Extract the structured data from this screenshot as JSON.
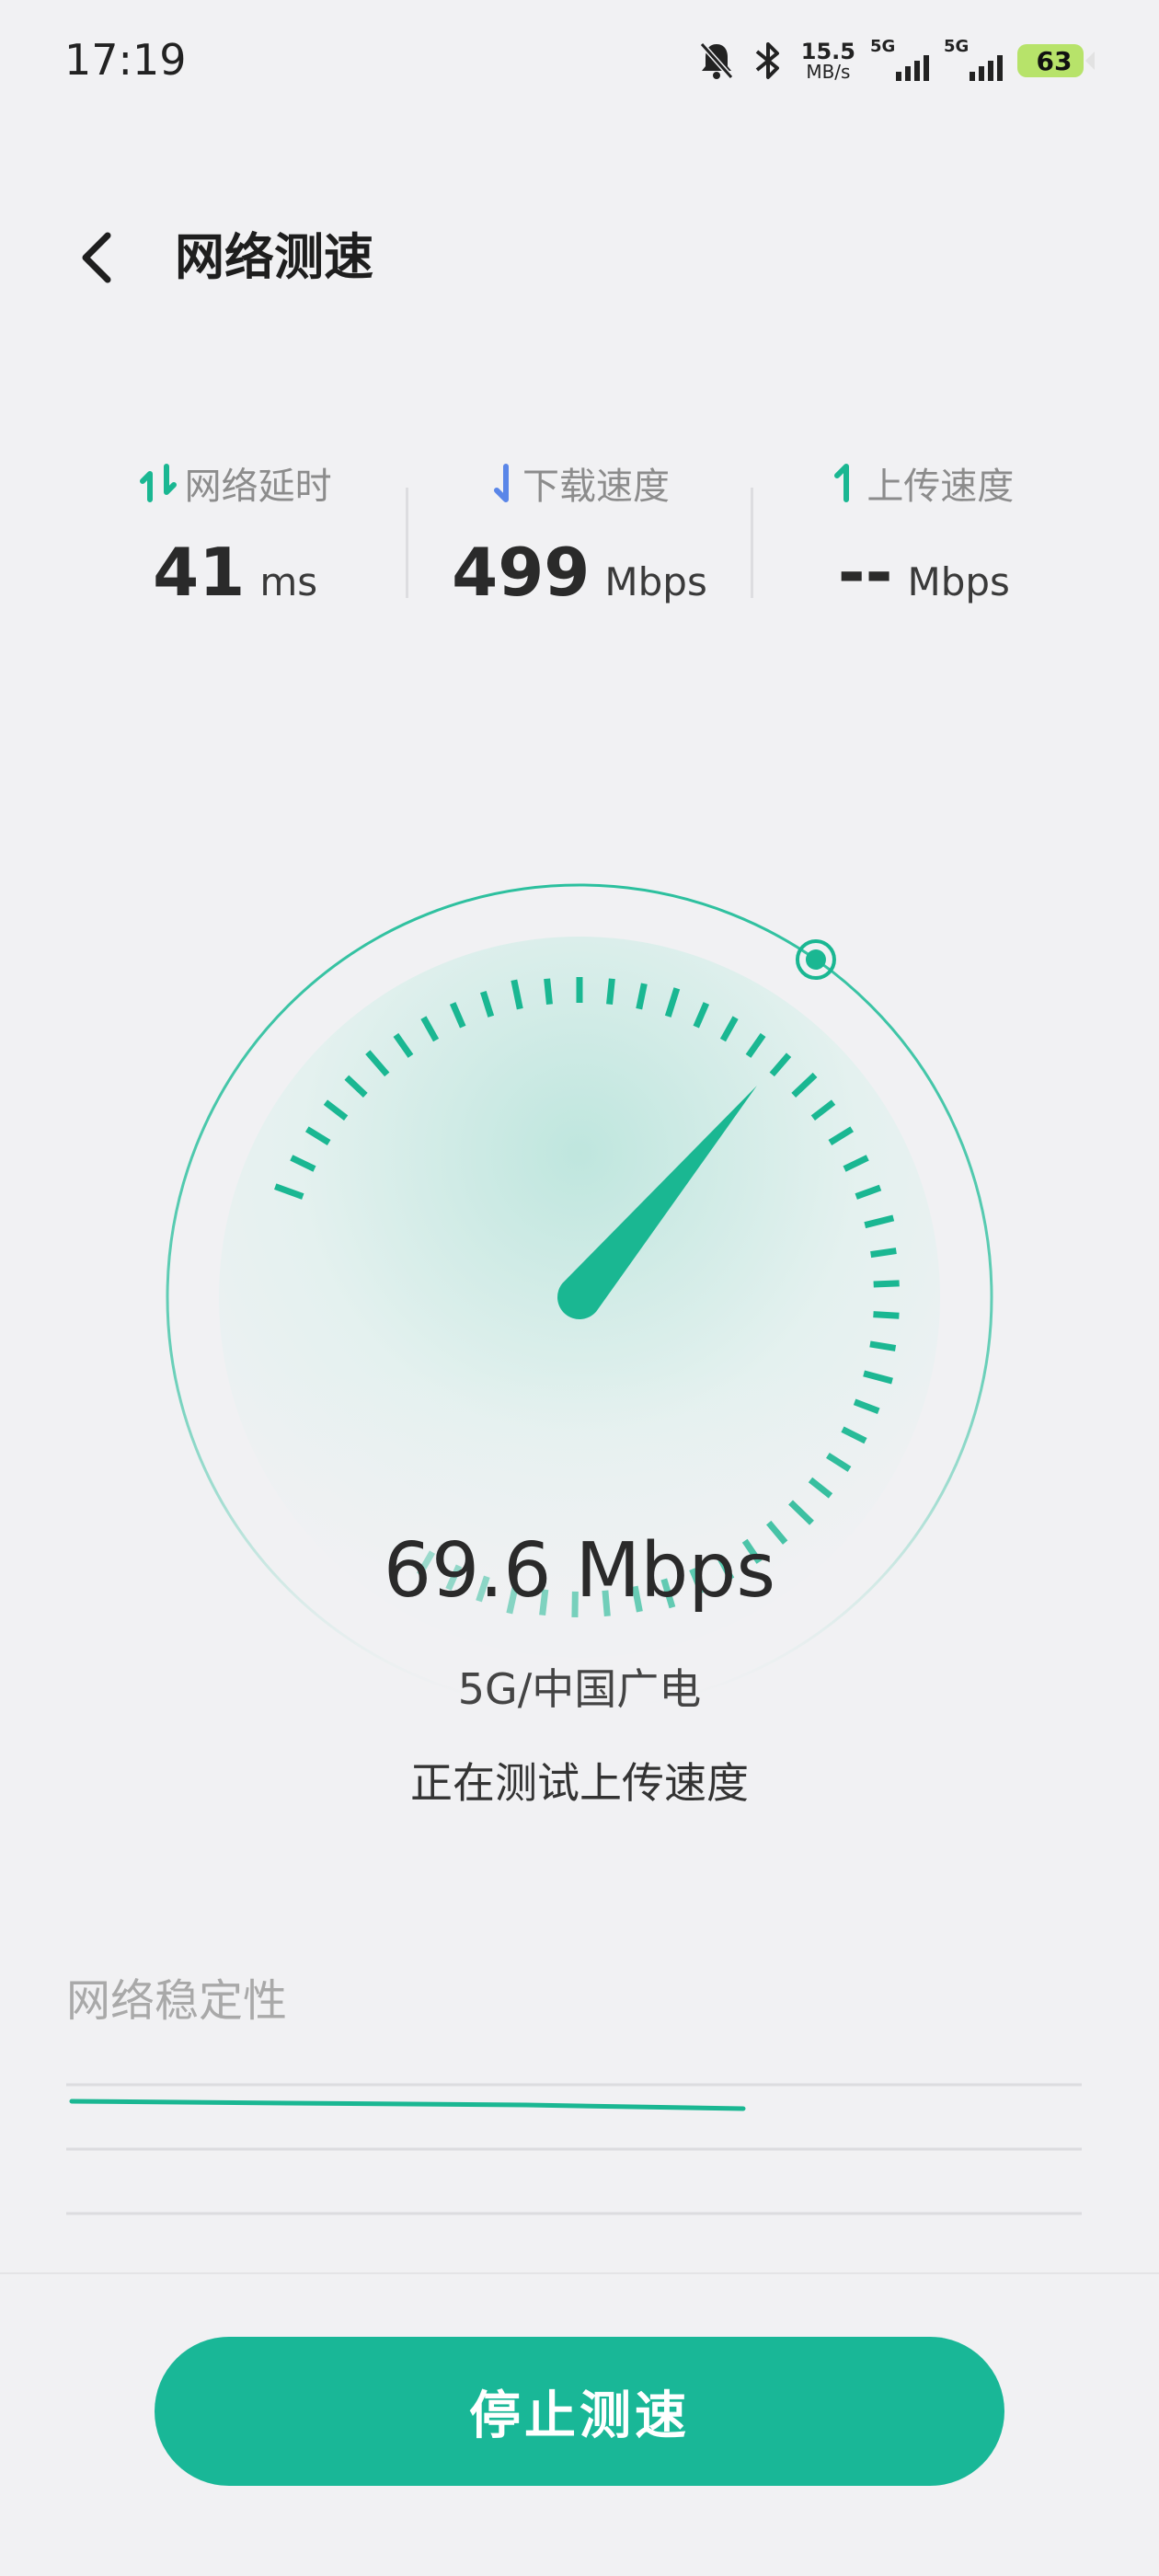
{
  "status_bar": {
    "time": "17:19",
    "net_speed_value": "15.5",
    "net_speed_unit": "MB/s",
    "sim1_tag": "5G",
    "sim2_tag": "5G",
    "battery": "63",
    "icons": [
      "bell-off-icon",
      "bluetooth-icon"
    ]
  },
  "header": {
    "title": "网络测速"
  },
  "metrics": {
    "latency": {
      "label": "网络延时",
      "value": "41",
      "unit": "ms",
      "icon": "up-down-arrows-icon",
      "color": "#1ab792"
    },
    "download": {
      "label": "下载速度",
      "value": "499",
      "unit": "Mbps",
      "icon": "down-arrow-icon",
      "color": "#5a86e8"
    },
    "upload": {
      "label": "上传速度",
      "value": "--",
      "unit": "Mbps",
      "icon": "up-arrow-icon",
      "color": "#1ab792"
    }
  },
  "gauge": {
    "current_speed_mbps": 69.6,
    "accent": "#1ab792"
  },
  "result": {
    "speed_text": "69.6 Mbps",
    "carrier": "5G/中国广电",
    "status": "正在测试上传速度"
  },
  "stability": {
    "title": "网络稳定性"
  },
  "actions": {
    "stop_label": "停止测速"
  }
}
